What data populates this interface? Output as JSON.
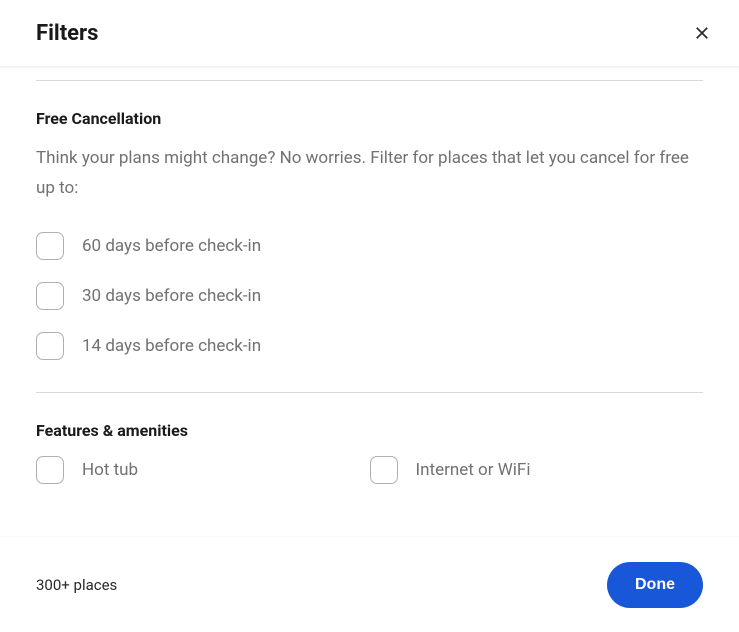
{
  "header": {
    "title": "Filters"
  },
  "cancellation": {
    "title": "Free Cancellation",
    "description": "Think your plans might change? No worries. Filter for places that let you cancel for free up to:",
    "options": [
      "60 days before check-in",
      "30 days before check-in",
      "14 days before check-in"
    ]
  },
  "amenities": {
    "title": "Features & amenities",
    "items": [
      "Hot tub",
      "Internet or WiFi"
    ]
  },
  "footer": {
    "result_count": "300+ places",
    "done_label": "Done"
  }
}
